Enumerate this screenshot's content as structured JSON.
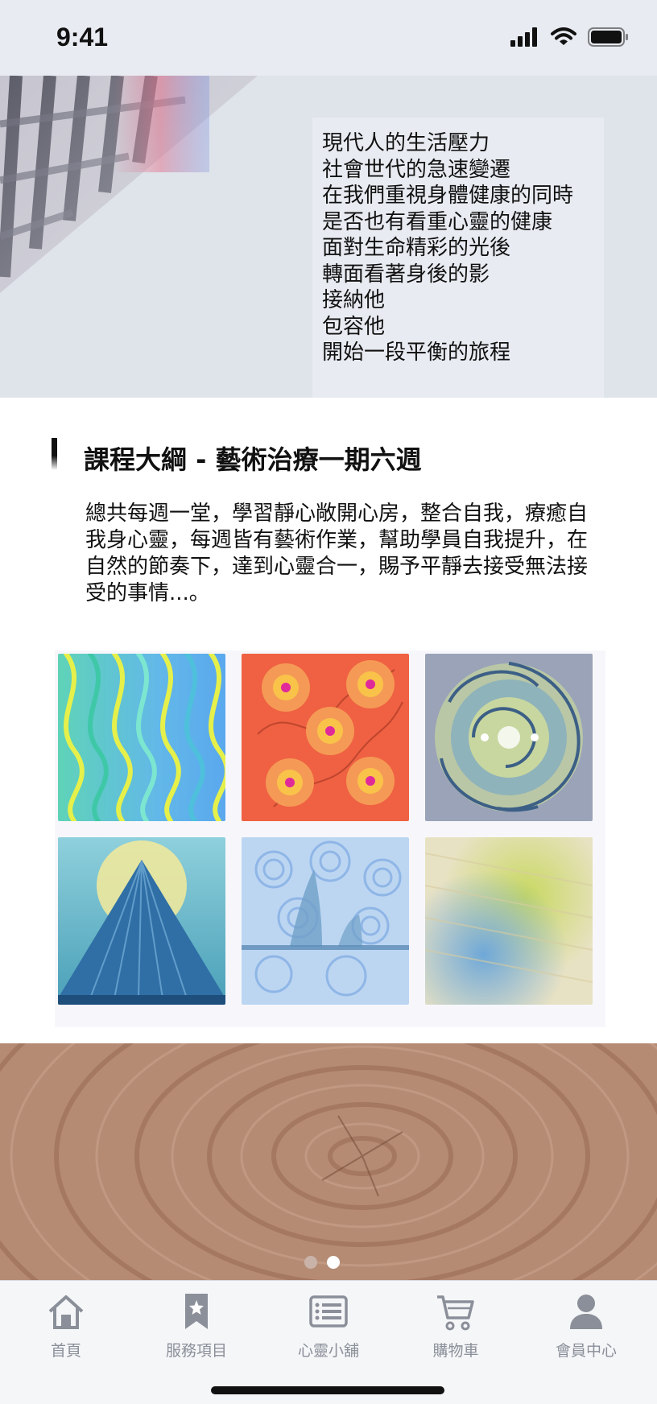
{
  "status_bar": {
    "time": "9:41"
  },
  "hero": {
    "lines": [
      "現代人的生活壓力",
      "社會世代的急速變遷",
      "在我們重視身體健康的同時",
      "是否也有看重心靈的健康",
      "面對生命精彩的光後",
      "轉面看著身後的影",
      "接納他",
      "包容他",
      "開始一段平衡的旅程"
    ]
  },
  "course": {
    "title": "課程大綱 - 藝術治療一期六週",
    "description": "總共每週一堂，學習靜心敞開心房，整合自我，療癒自我身心靈，每週皆有藝術作業，幫助學員自我提升，在自然的節奏下，達到心靈合一，賜予平靜去接受無法接受的事情...。"
  },
  "gallery": {
    "images": [
      "wavy-lines-art",
      "orange-flowers-art",
      "spiral-mandala-art",
      "mountain-art",
      "swirling-clouds-art",
      "blurred-pastel-art"
    ]
  },
  "pager": {
    "pages": 2,
    "active": 1,
    "active_color": "#ffffff",
    "inactive_color": "#c9b3a8"
  },
  "tabbar": {
    "items": [
      {
        "label": "首頁",
        "icon": "home-icon"
      },
      {
        "label": "服務項目",
        "icon": "bookmark-star-icon"
      },
      {
        "label": "心靈小舖",
        "icon": "list-icon"
      },
      {
        "label": "購物車",
        "icon": "cart-icon"
      },
      {
        "label": "會員中心",
        "icon": "user-icon"
      }
    ],
    "icon_color": "#8a8f99"
  }
}
